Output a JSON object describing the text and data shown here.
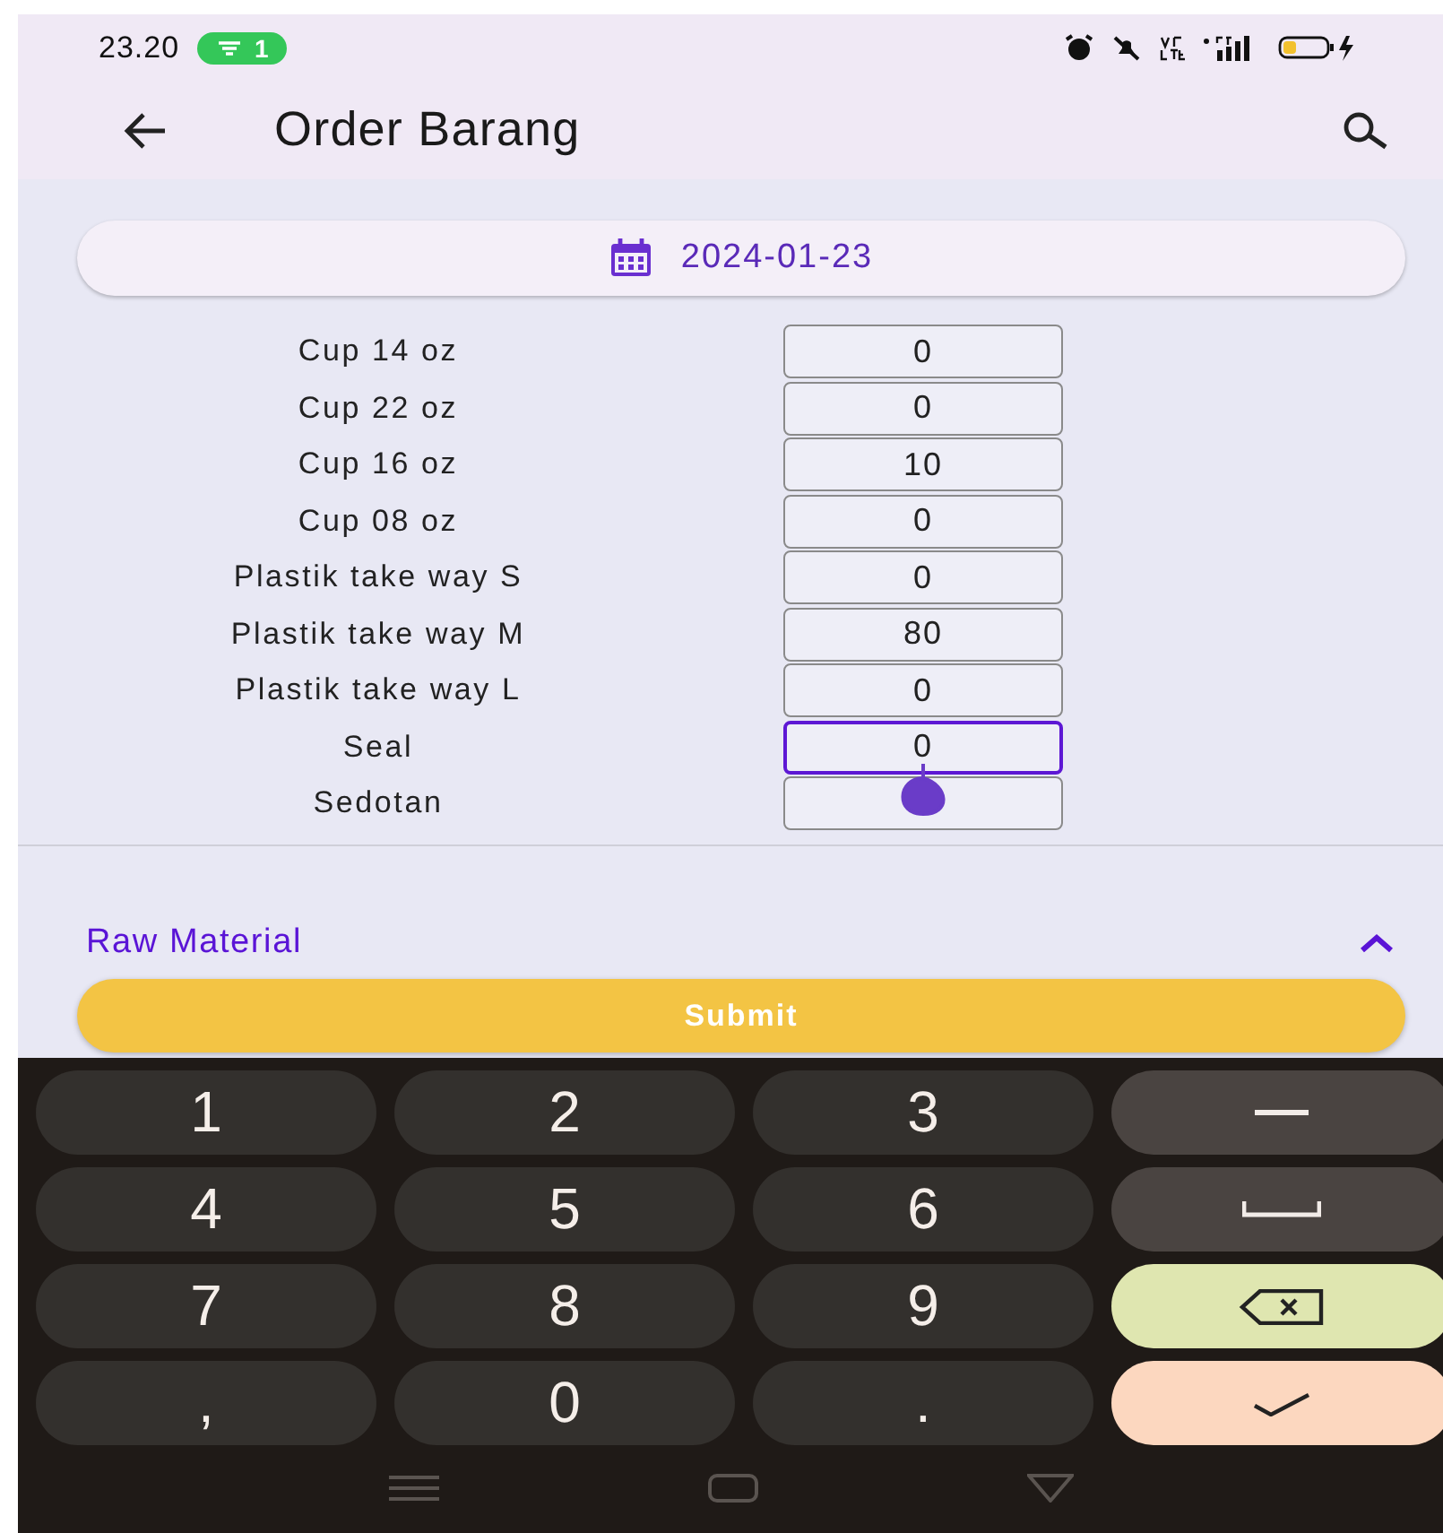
{
  "status_bar": {
    "time": "23.20",
    "hotspot_badge": "1"
  },
  "app_bar": {
    "title": "Order Barang"
  },
  "date": "2024-01-23",
  "items": [
    {
      "name": "Cup 14 oz",
      "value": "0",
      "focused": false
    },
    {
      "name": "Cup 22 oz",
      "value": "0",
      "focused": false
    },
    {
      "name": "Cup 16 oz",
      "value": "10",
      "focused": false
    },
    {
      "name": "Cup 08 oz",
      "value": "0",
      "focused": false
    },
    {
      "name": "Plastik take way S",
      "value": "0",
      "focused": false
    },
    {
      "name": "Plastik take way M",
      "value": "80",
      "focused": false
    },
    {
      "name": "Plastik take way L",
      "value": "0",
      "focused": false
    },
    {
      "name": "Seal",
      "value": "0",
      "focused": true
    },
    {
      "name": "Sedotan",
      "focused": false
    }
  ],
  "section": {
    "title": "Raw Material",
    "expanded": true
  },
  "submit": "Submit",
  "keyboard": [
    {
      "kind": "char",
      "label": "1"
    },
    {
      "kind": "char",
      "label": "2"
    },
    {
      "kind": "char",
      "label": "3"
    },
    {
      "kind": "minus"
    },
    {
      "kind": "char",
      "label": "4"
    },
    {
      "kind": "char",
      "label": "5"
    },
    {
      "kind": "char",
      "label": "6"
    },
    {
      "kind": "space"
    },
    {
      "kind": "char",
      "label": "7"
    },
    {
      "kind": "char",
      "label": "8"
    },
    {
      "kind": "char",
      "label": "9"
    },
    {
      "kind": "backspace"
    },
    {
      "kind": "char",
      "label": ","
    },
    {
      "kind": "char",
      "label": "0"
    },
    {
      "kind": "char",
      "label": "."
    },
    {
      "kind": "enter"
    }
  ]
}
